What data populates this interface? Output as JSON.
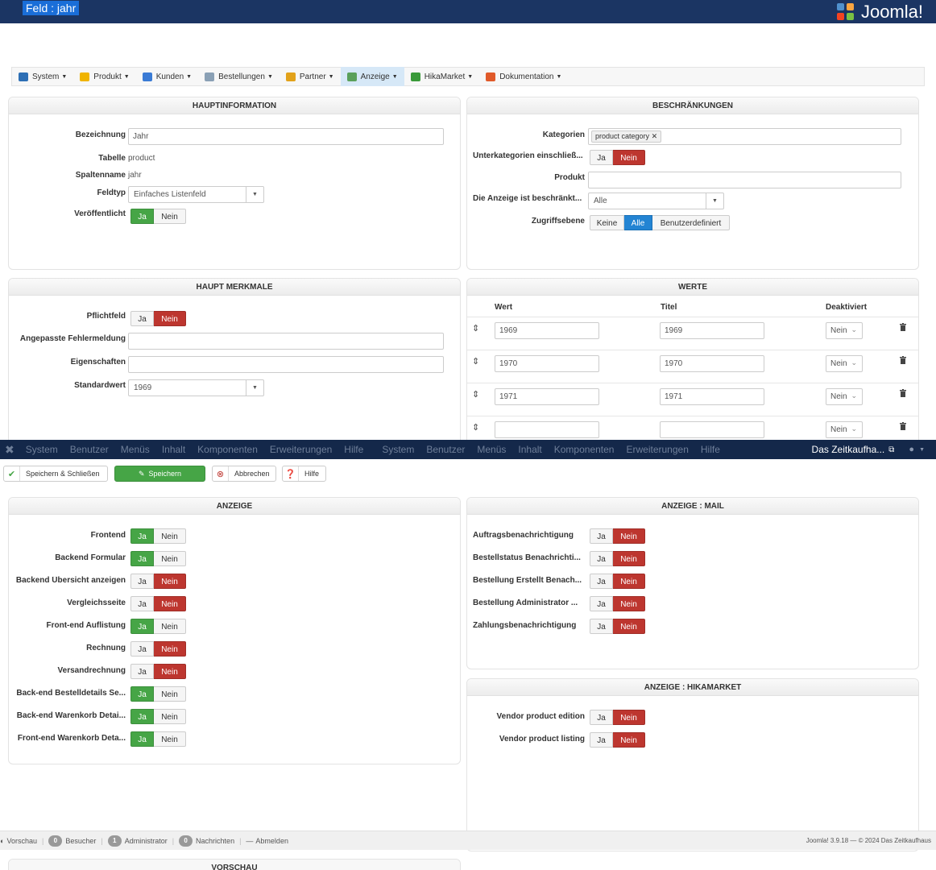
{
  "header": {
    "title": "Feld : jahr",
    "logo_text": "Joomla!"
  },
  "hika_menu": [
    {
      "label": "System",
      "icon": "wrench-icon",
      "color": "#2d6fb5"
    },
    {
      "label": "Produkt",
      "icon": "box-icon",
      "color": "#f0b400"
    },
    {
      "label": "Kunden",
      "icon": "users-icon",
      "color": "#3a7bd5"
    },
    {
      "label": "Bestellungen",
      "icon": "orders-icon",
      "color": "#8aa0b5"
    },
    {
      "label": "Partner",
      "icon": "partner-icon",
      "color": "#e2a21a"
    },
    {
      "label": "Anzeige",
      "icon": "display-icon",
      "color": "#5aa05a",
      "active": true
    },
    {
      "label": "HikaMarket",
      "icon": "hikamarket-icon",
      "color": "#3a9a3a"
    },
    {
      "label": "Dokumentation",
      "icon": "help-lifebuoy-icon",
      "color": "#e05a2a"
    }
  ],
  "hauptinformation": {
    "title": "HAUPTINFORMATION",
    "bezeichnung_label": "Bezeichnung",
    "bezeichnung_value": "Jahr",
    "tabelle_label": "Tabelle",
    "tabelle_value": "product",
    "spaltenname_label": "Spaltenname",
    "spaltenname_value": "jahr",
    "feldtyp_label": "Feldtyp",
    "feldtyp_value": "Einfaches Listenfeld",
    "veroeffentlicht_label": "Veröffentlicht"
  },
  "beschraenkungen": {
    "title": "BESCHRÄNKUNGEN",
    "kategorien_label": "Kategorien",
    "kategorien_tag": "product category",
    "unterkategorien_label": "Unterkategorien einschließ...",
    "produkt_label": "Produkt",
    "anzeige_beschraenkt_label": "Die Anzeige ist beschränkt...",
    "anzeige_beschraenkt_value": "Alle",
    "zugriffsebene_label": "Zugriffsebene",
    "zugriff_keine": "Keine",
    "zugriff_alle": "Alle",
    "zugriff_benutzer": "Benutzerdefiniert"
  },
  "haupt_merkmale": {
    "title": "HAUPT MERKMALE",
    "pflichtfeld_label": "Pflichtfeld",
    "fehlermeldung_label": "Angepasste Fehlermeldung",
    "eigenschaften_label": "Eigenschaften",
    "standardwert_label": "Standardwert",
    "standardwert_value": "1969"
  },
  "werte": {
    "title": "WERTE",
    "col_wert": "Wert",
    "col_titel": "Titel",
    "col_deaktiviert": "Deaktiviert",
    "rows": [
      {
        "wert": "1969",
        "titel": "1969",
        "deaktiviert": "Nein"
      },
      {
        "wert": "1970",
        "titel": "1970",
        "deaktiviert": "Nein"
      },
      {
        "wert": "1971",
        "titel": "1971",
        "deaktiviert": "Nein"
      },
      {
        "wert": "",
        "titel": "",
        "deaktiviert": "Nein"
      }
    ]
  },
  "toggle": {
    "ja": "Ja",
    "nein": "Nein"
  },
  "admin_menu": {
    "items": [
      "System",
      "Benutzer",
      "Menüs",
      "Inhalt",
      "Komponenten",
      "Erweiterungen",
      "Hilfe",
      "System",
      "Benutzer",
      "Menüs",
      "Inhalt",
      "Komponenten",
      "Erweiterungen",
      "Hilfe"
    ],
    "site_name": "Das Zeitkaufha..."
  },
  "toolbar": {
    "save_close": "Speichern & Schließen",
    "save": "Speichern",
    "cancel": "Abbrechen",
    "help": "Hilfe"
  },
  "anzeige": {
    "title": "ANZEIGE",
    "items": [
      {
        "label": "Frontend",
        "value": "ja"
      },
      {
        "label": "Backend Formular",
        "value": "ja"
      },
      {
        "label": "Backend Übersicht anzeigen",
        "value": "nein"
      },
      {
        "label": "Vergleichsseite",
        "value": "nein"
      },
      {
        "label": "Front-end Auflistung",
        "value": "ja"
      },
      {
        "label": "Rechnung",
        "value": "nein"
      },
      {
        "label": "Versandrechnung",
        "value": "nein"
      },
      {
        "label": "Back-end Bestelldetails Se...",
        "value": "ja"
      },
      {
        "label": "Back-end Warenkorb Detai...",
        "value": "ja"
      },
      {
        "label": "Front-end Warenkorb Deta...",
        "value": "ja"
      }
    ]
  },
  "anzeige_mail": {
    "title": "ANZEIGE : MAIL",
    "items": [
      {
        "label": "Auftragsbenachrichtigung",
        "value": "nein"
      },
      {
        "label": "Bestellstatus Benachrichti...",
        "value": "nein"
      },
      {
        "label": "Bestellung Erstellt Benach...",
        "value": "nein"
      },
      {
        "label": "Bestellung Administrator ...",
        "value": "nein"
      },
      {
        "label": "Zahlungsbenachrichtigung",
        "value": "nein"
      }
    ]
  },
  "anzeige_hikamarket": {
    "title": "ANZEIGE : HIKAMARKET",
    "items": [
      {
        "label": "Vendor product edition",
        "value": "nein"
      },
      {
        "label": "Vendor product listing",
        "value": "nein"
      }
    ]
  },
  "status_bar": {
    "vorschau": "Vorschau",
    "besucher_count": "0",
    "besucher": "Besucher",
    "admin_count": "1",
    "admin": "Administrator",
    "nachrichten_count": "0",
    "nachrichten": "Nachrichten",
    "abmelden": "Abmelden",
    "footer": "Joomla! 3.9.18 — © 2024 Das Zeitkaufhaus"
  },
  "vorschau_panel": {
    "title": "VORSCHAU"
  }
}
